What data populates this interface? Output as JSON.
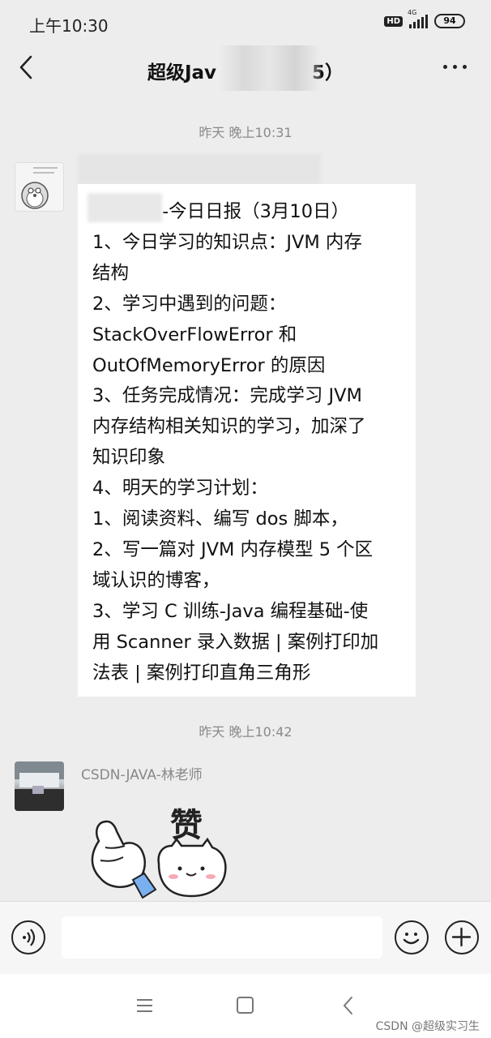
{
  "status_bar": {
    "time": "上午10:30",
    "hd": "HD",
    "network": "4G",
    "battery": "94"
  },
  "nav": {
    "title_left": "超级Jav",
    "title_right": "5）",
    "back_icon": "chevron-left-icon",
    "more_icon": "more-icon"
  },
  "messages": [
    {
      "timestamp": "昨天 晚上10:31",
      "lines": [
        "-今日日报（3月10日）",
        "1、今日学习的知识点：JVM 内存",
        "结构",
        "2、学习中遇到的问题：",
        "StackOverFlowError 和",
        "OutOfMemoryError 的原因",
        "3、任务完成情况：完成学习 JVM",
        "内存结构相关知识的学习，加深了",
        "知识印象",
        "4、明天的学习计划：",
        " 1、阅读资料、编写 dos 脚本，",
        "2、写一篇对 JVM 内存模型 5 个区",
        "域认识的博客，",
        "3、学习 C 训练-Java 编程基础-使",
        "用 Scanner 录入数据 | 案例打印加",
        "法表 | 案例打印直角三角形"
      ]
    },
    {
      "timestamp": "昨天 晚上10:42",
      "sender": "CSDN-JAVA-林老师",
      "sticker_text": "赞"
    }
  ],
  "input": {
    "value": "",
    "placeholder": ""
  },
  "watermark": "CSDN @超级实习生"
}
